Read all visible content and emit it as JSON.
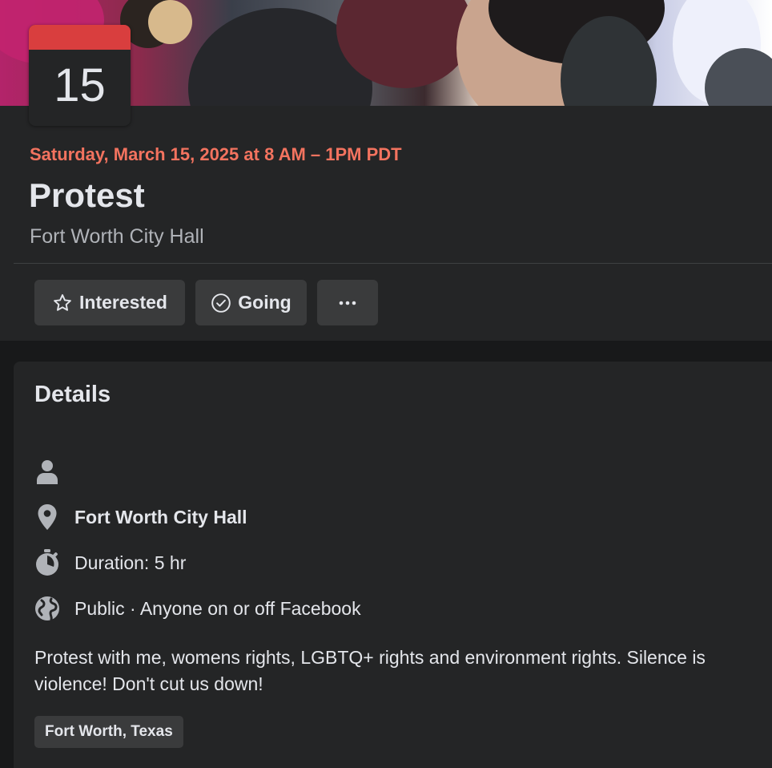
{
  "cover": {
    "image": "protest-crowd-photo"
  },
  "calendar": {
    "day": "15"
  },
  "event": {
    "date_line": "Saturday, March 15, 2025 at 8 AM – 1PM PDT",
    "title": "Protest",
    "location": "Fort Worth City Hall"
  },
  "actions": {
    "interested_label": "Interested",
    "going_label": "Going",
    "more_label": "···"
  },
  "details": {
    "heading": "Details",
    "host_text": "",
    "location_text": "Fort Worth City Hall",
    "duration_text": "Duration: 5 hr",
    "privacy_text": "Public · Anyone on or off Facebook",
    "description": "Protest with me, womens rights, LGBTQ+ rights and environment rights. Silence is violence! Don't cut us down!",
    "tag": "Fort Worth, Texas"
  },
  "icons": {
    "interested": "star-icon",
    "going": "check-circle-icon",
    "host": "person-icon",
    "location": "map-pin-icon",
    "duration": "stopwatch-icon",
    "privacy": "globe-icon"
  },
  "colors": {
    "background": "#18191a",
    "card": "#242526",
    "button": "#3a3b3c",
    "date_accent": "#f3735f",
    "calendar_header": "#d93e3e",
    "icon_gray": "#b0b3b8"
  }
}
